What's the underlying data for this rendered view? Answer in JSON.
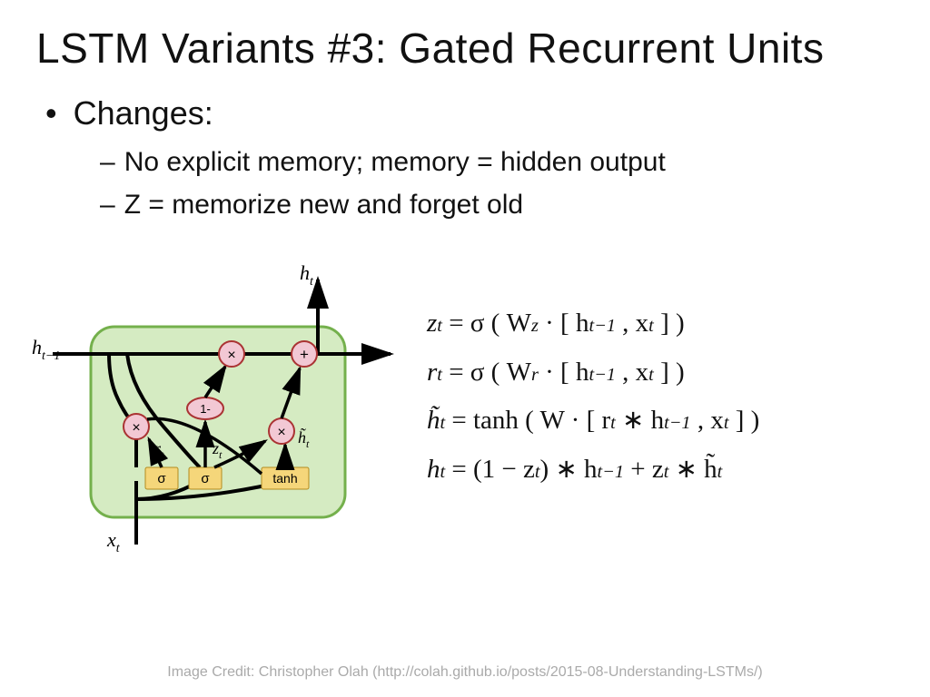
{
  "title": "LSTM Variants #3: Gated Recurrent Units",
  "bullet": "Changes:",
  "sub_bullets": [
    "No explicit memory; memory = hidden output",
    "Z = memorize new and forget old"
  ],
  "diagram": {
    "h_prev": "h",
    "h_prev_sub": "t−1",
    "x": "x",
    "x_sub": "t",
    "h_out": "h",
    "h_out_sub": "t",
    "r_lbl": "r",
    "r_sub": "t",
    "z_lbl": "z",
    "z_sub": "t",
    "htilde_lbl": "h̃",
    "htilde_sub": "t",
    "sigma": "σ",
    "tanh": "tanh",
    "one_minus": "1-",
    "mult": "×",
    "plus": "+"
  },
  "equations": {
    "line1_lhs": "z",
    "line1_lhs_sub": "t",
    "line1_rhs_before": " = σ ( W",
    "line1_rhs_Wsub": "z",
    "line1_rhs_after": " · [ h",
    "line1_rhs_hsub": "t−1",
    "line1_rhs_end": " , x",
    "line1_rhs_xsub": "t",
    "line1_rhs_close": " ] )",
    "line2_lhs": "r",
    "line2_lhs_sub": "t",
    "line2_rhs_before": " = σ ( W",
    "line2_rhs_Wsub": "r",
    "line2_rhs_after": " · [ h",
    "line2_rhs_hsub": "t−1",
    "line2_rhs_end": " , x",
    "line2_rhs_xsub": "t",
    "line2_rhs_close": " ] )",
    "line3_lhs": "h̃",
    "line3_lhs_sub": "t",
    "line3_rhs_tanh": " = tanh ( W · [ r",
    "line3_rhs_rsub": "t",
    "line3_rhs_mid": " ∗ h",
    "line3_rhs_hsub": "t−1",
    "line3_rhs_end": " , x",
    "line3_rhs_xsub": "t",
    "line3_rhs_close": " ] )",
    "line4_lhs": "h",
    "line4_lhs_sub": "t",
    "line4_rhs_a": " = (1 − z",
    "line4_rhs_zsub1": "t",
    "line4_rhs_b": ") ∗ h",
    "line4_rhs_hsub": "t−1",
    "line4_rhs_c": " + z",
    "line4_rhs_zsub2": "t",
    "line4_rhs_d": " ∗ h̃",
    "line4_rhs_htsub": "t"
  },
  "credit": "Image Credit: Christopher Olah (http://colah.github.io/posts/2015-08-Understanding-LSTMs/)"
}
